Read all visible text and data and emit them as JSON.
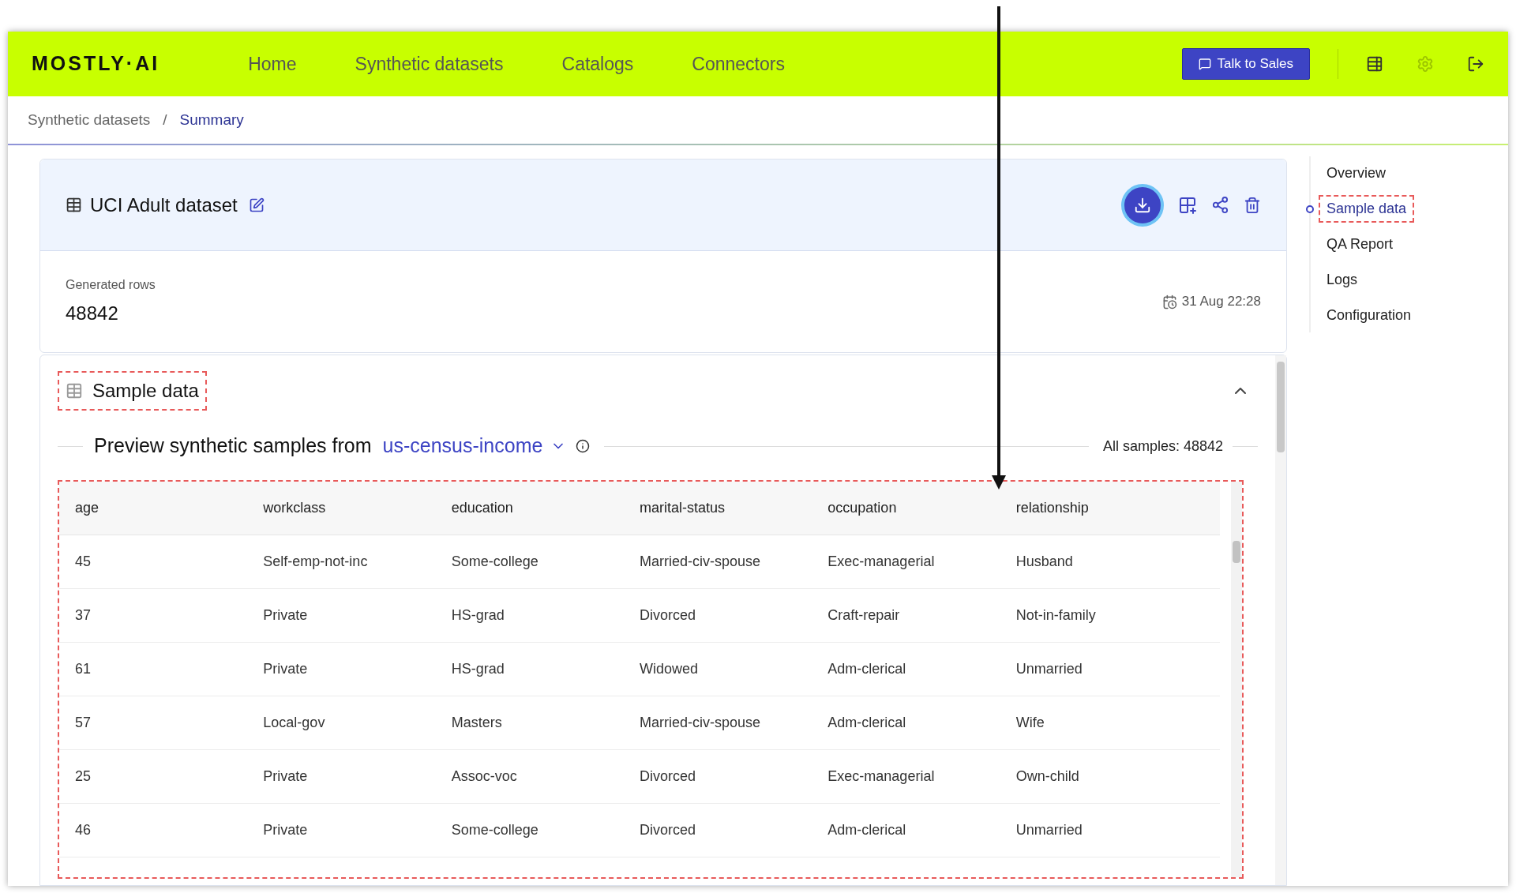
{
  "header": {
    "logo": "MOSTLY·AI",
    "nav": [
      "Home",
      "Synthetic datasets",
      "Catalogs",
      "Connectors"
    ],
    "cta": "Talk to Sales"
  },
  "breadcrumb": {
    "items": [
      "Synthetic datasets",
      "Summary"
    ],
    "separator": "/"
  },
  "dataset": {
    "title": "UCI Adult dataset",
    "rows_label": "Generated rows",
    "rows": "48842",
    "date": "31 Aug 22:28"
  },
  "sample": {
    "title": "Sample data",
    "preview_label": "Preview synthetic samples from",
    "source": "us-census-income",
    "all_samples": "All samples: 48842",
    "table": {
      "columns": [
        "age",
        "workclass",
        "education",
        "marital-status",
        "occupation",
        "relationship"
      ],
      "rows": [
        [
          "45",
          "Self-emp-not-inc",
          "Some-college",
          "Married-civ-spouse",
          "Exec-managerial",
          "Husband"
        ],
        [
          "37",
          "Private",
          "HS-grad",
          "Divorced",
          "Craft-repair",
          "Not-in-family"
        ],
        [
          "61",
          "Private",
          "HS-grad",
          "Widowed",
          "Adm-clerical",
          "Unmarried"
        ],
        [
          "57",
          "Local-gov",
          "Masters",
          "Married-civ-spouse",
          "Adm-clerical",
          "Wife"
        ],
        [
          "25",
          "Private",
          "Assoc-voc",
          "Divorced",
          "Exec-managerial",
          "Own-child"
        ],
        [
          "46",
          "Private",
          "Some-college",
          "Divorced",
          "Adm-clerical",
          "Unmarried"
        ]
      ]
    }
  },
  "toc": [
    {
      "label": "Overview",
      "selected": false
    },
    {
      "label": "Sample data",
      "selected": true
    },
    {
      "label": "QA Report",
      "selected": false
    },
    {
      "label": "Logs",
      "selected": false
    },
    {
      "label": "Configuration",
      "selected": false
    }
  ]
}
